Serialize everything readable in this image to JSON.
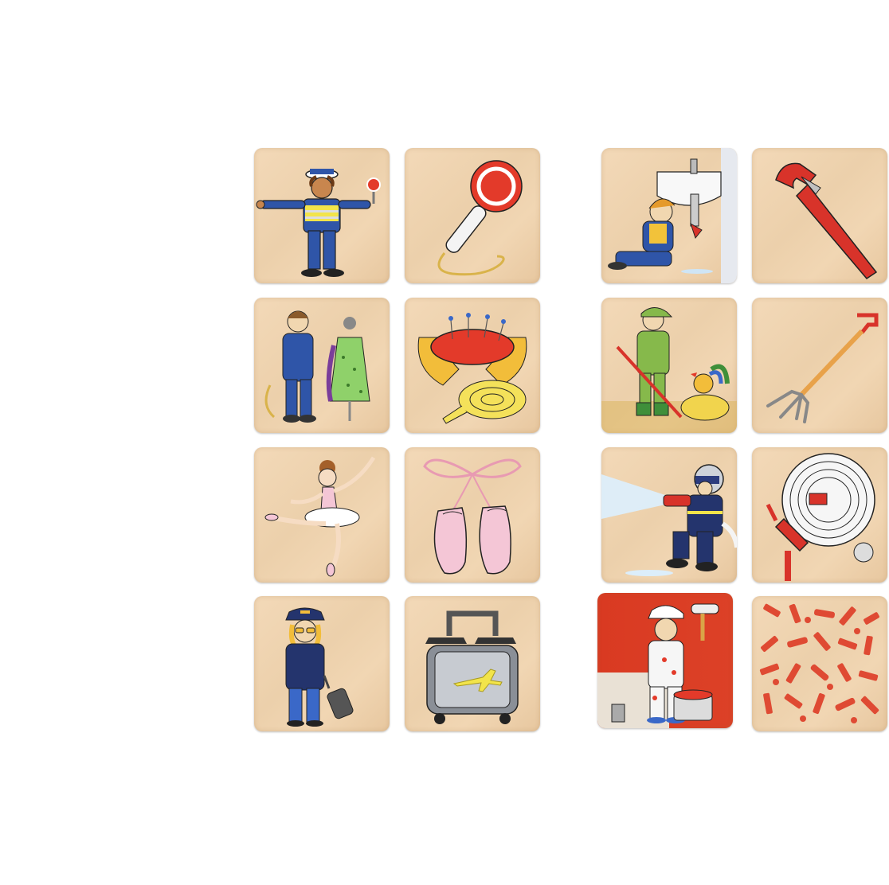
{
  "scene": "memory-game-tiles",
  "colors": {
    "wood": "#eed3ae",
    "police_blue": "#2f55a8",
    "hi_vis_yellow": "#f2e44a",
    "signal_red": "#e33a2a",
    "wrench_red": "#d8332a",
    "ballet_pink": "#f4c6d6",
    "fire_navy": "#24346d",
    "painter_red": "#db3b24",
    "hay_yellow": "#f1d44d",
    "farmer_green": "#86b94b"
  },
  "tiles": [
    {
      "row": 1,
      "col": 1,
      "icon": "traffic-police-officer-icon"
    },
    {
      "row": 1,
      "col": 2,
      "icon": "stop-paddle-icon"
    },
    {
      "row": 1,
      "col": 3,
      "icon": "plumber-icon"
    },
    {
      "row": 1,
      "col": 4,
      "icon": "pipe-wrench-icon"
    },
    {
      "row": 2,
      "col": 1,
      "icon": "tailor-icon"
    },
    {
      "row": 2,
      "col": 2,
      "icon": "pincushion-tape-measure-icon"
    },
    {
      "row": 2,
      "col": 3,
      "icon": "farmer-icon"
    },
    {
      "row": 2,
      "col": 4,
      "icon": "pitchfork-icon"
    },
    {
      "row": 3,
      "col": 1,
      "icon": "ballerina-icon"
    },
    {
      "row": 3,
      "col": 2,
      "icon": "ballet-shoes-icon"
    },
    {
      "row": 3,
      "col": 3,
      "icon": "firefighter-icon"
    },
    {
      "row": 3,
      "col": 4,
      "icon": "fire-hose-icon"
    },
    {
      "row": 4,
      "col": 1,
      "icon": "pilot-icon"
    },
    {
      "row": 4,
      "col": 2,
      "icon": "travel-suitcase-icon"
    },
    {
      "row": 4,
      "col": 3,
      "icon": "painter-icon"
    },
    {
      "row": 4,
      "col": 4,
      "icon": "tile-back-pattern-icon"
    }
  ]
}
